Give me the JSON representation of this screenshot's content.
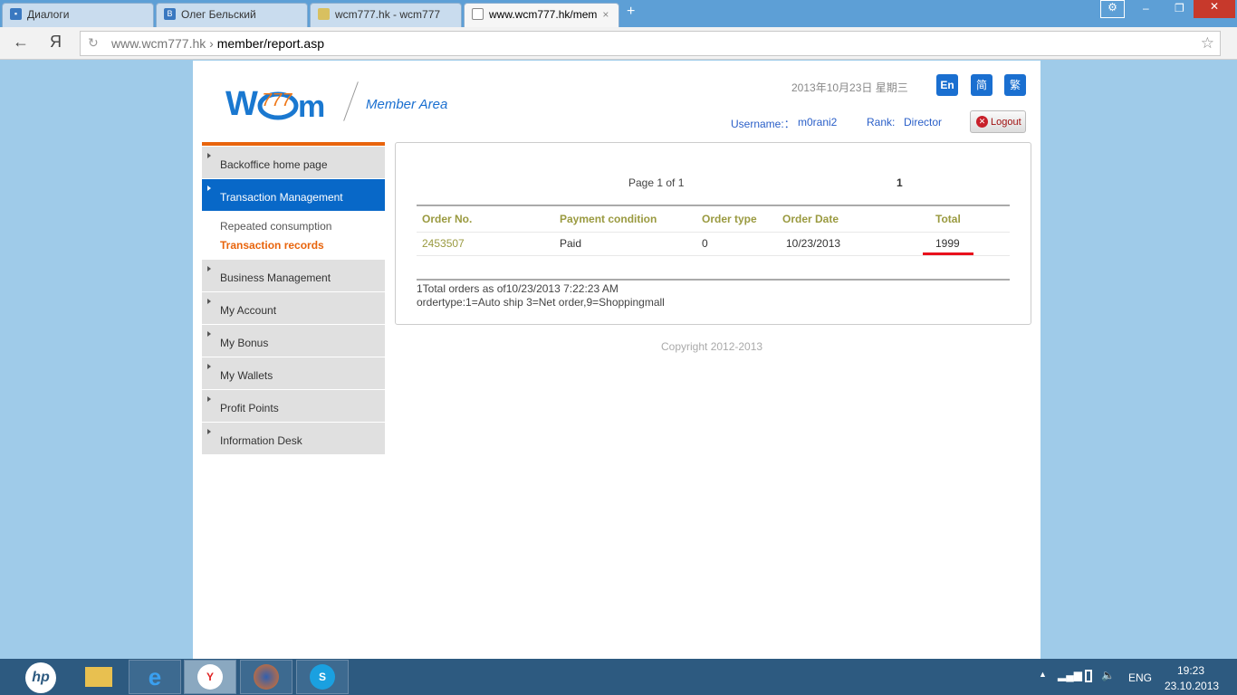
{
  "browser": {
    "tabs": [
      {
        "label": "Диалоги",
        "icon": "chat-icon"
      },
      {
        "label": "Олег Бельский",
        "icon": "vk-icon"
      },
      {
        "label": "wcm777.hk - wcm777",
        "icon": "page-icon"
      },
      {
        "label": "www.wcm777.hk/mem",
        "icon": "document-icon"
      }
    ],
    "url_domain": "www.wcm777.hk",
    "url_sep": "›",
    "url_path": "member/report.asp",
    "back": "←",
    "yandex": "Я",
    "reload": "↻",
    "star": "☆",
    "new_tab": "+"
  },
  "header": {
    "logo": "wcm777",
    "member_area": "Member Area",
    "date": "2013年10月23日  星期三",
    "lang": [
      "En",
      "简",
      "繁"
    ],
    "username_label": "Username:：",
    "username": "m0rani2",
    "rank_label": "Rank:",
    "rank": "Director",
    "logout": "Logout"
  },
  "sidebar": {
    "items": [
      "Backoffice home page",
      "Transaction Management",
      "Business Management",
      "My Account",
      "My Bonus",
      "My Wallets",
      "Profit Points",
      "Information Desk"
    ],
    "sub": [
      "Repeated consumption",
      "Transaction records"
    ]
  },
  "report": {
    "page_info": "Page 1 of 1",
    "page_num": "1",
    "columns": [
      "Order No.",
      "Payment condition",
      "Order type",
      "Order Date",
      "Total"
    ],
    "rows": [
      [
        "2453507",
        "Paid",
        "0",
        "10/23/2013",
        "1999"
      ]
    ],
    "summary": "1Total orders as of10/23/2013  7:22:23 AM",
    "legend": "ordertype:1=Auto ship 3=Net order,9=Shoppingmall"
  },
  "footer": {
    "copyright": "Copyright 2012-2013"
  },
  "taskbar": {
    "lang": "ENG",
    "time": "19:23",
    "date": "23.10.2013"
  }
}
